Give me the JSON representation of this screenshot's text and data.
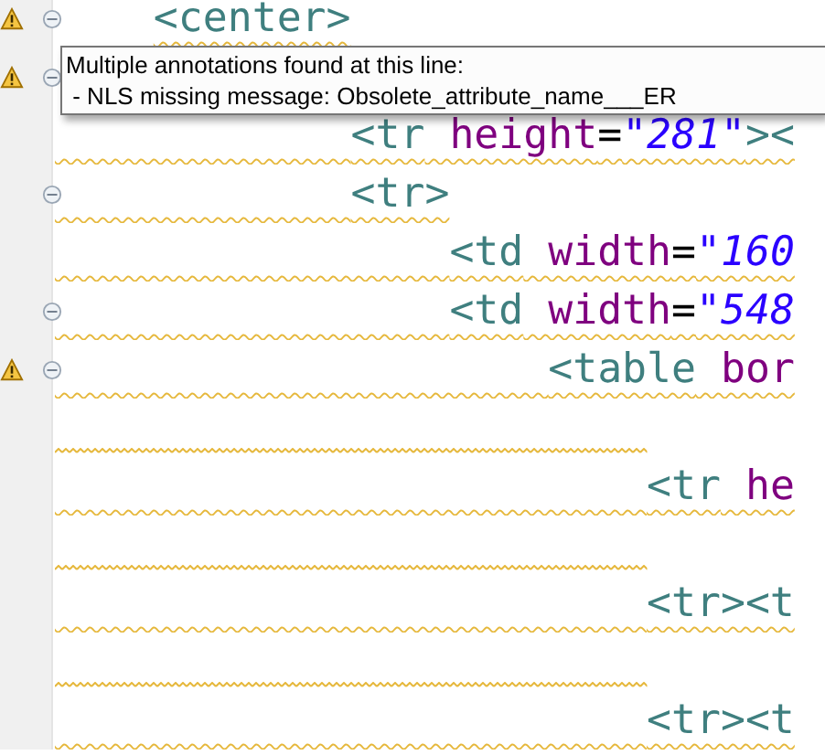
{
  "editor": {
    "lines": [
      {
        "warning": true,
        "fold": true,
        "underlined": true,
        "underline_indent": false,
        "tokens": [
          {
            "kind": "tag",
            "text": "<center>"
          }
        ],
        "children": [
          {
            "warning": true,
            "fold": true,
            "children": [
              {
                "warning": false,
                "fold": false,
                "underlined": true,
                "underline_indent": true,
                "tokens": [
                  {
                    "kind": "tag",
                    "text": "<tr"
                  },
                  {
                    "kind": "attr",
                    "text": " height"
                  },
                  {
                    "kind": "punct",
                    "text": "="
                  },
                  {
                    "kind": "value",
                    "text": "\"281\""
                  },
                  {
                    "kind": "tag",
                    "text": "><"
                  }
                ]
              },
              {
                "warning": false,
                "fold": true,
                "underlined": true,
                "underline_indent": true,
                "tokens": [
                  {
                    "kind": "tag",
                    "text": "<tr>"
                  }
                ],
                "children": [
                  {
                    "warning": false,
                    "fold": false,
                    "underlined": true,
                    "underline_indent": true,
                    "tokens": [
                      {
                        "kind": "tag",
                        "text": "<td"
                      },
                      {
                        "kind": "attr",
                        "text": " width"
                      },
                      {
                        "kind": "punct",
                        "text": "="
                      },
                      {
                        "kind": "value",
                        "text": "\"160"
                      }
                    ]
                  },
                  {
                    "warning": false,
                    "fold": true,
                    "underlined": true,
                    "underline_indent": true,
                    "tokens": [
                      {
                        "kind": "tag",
                        "text": "<td"
                      },
                      {
                        "kind": "attr",
                        "text": " width"
                      },
                      {
                        "kind": "punct",
                        "text": "="
                      },
                      {
                        "kind": "value",
                        "text": "\"548"
                      }
                    ],
                    "children": [
                      {
                        "warning": true,
                        "fold": true,
                        "underlined": true,
                        "underline_indent": true,
                        "tokens": [
                          {
                            "kind": "tag",
                            "text": "<table"
                          },
                          {
                            "kind": "attr",
                            "text": " bor"
                          }
                        ],
                        "children": [
                          {
                            "warning": false,
                            "fold": false,
                            "underlined": true,
                            "underline_indent": true
                          },
                          {
                            "warning": false,
                            "fold": false,
                            "underlined": true,
                            "underline_indent": true,
                            "tokens": [
                              {
                                "kind": "tag",
                                "text": "<tr"
                              },
                              {
                                "kind": "attr",
                                "text": " he"
                              }
                            ]
                          },
                          {
                            "warning": false,
                            "fold": false,
                            "underlined": true,
                            "underline_indent": true
                          },
                          {
                            "warning": false,
                            "fold": false,
                            "underlined": true,
                            "underline_indent": true,
                            "tokens": [
                              {
                                "kind": "tag",
                                "text": "<tr><t"
                              }
                            ]
                          },
                          {
                            "warning": false,
                            "fold": false,
                            "underlined": true,
                            "underline_indent": true
                          },
                          {
                            "warning": false,
                            "fold": false,
                            "underlined": true,
                            "underline_indent": true,
                            "tokens": [
                              {
                                "kind": "tag",
                                "text": "<tr><t"
                              }
                            ]
                          }
                        ]
                      }
                    ]
                  }
                ]
              }
            ]
          }
        ]
      }
    ]
  },
  "tooltip": {
    "lines": [
      "Multiple annotations found at this line:",
      " - NLS missing message: Obsolete_attribute_name___ER"
    ]
  }
}
